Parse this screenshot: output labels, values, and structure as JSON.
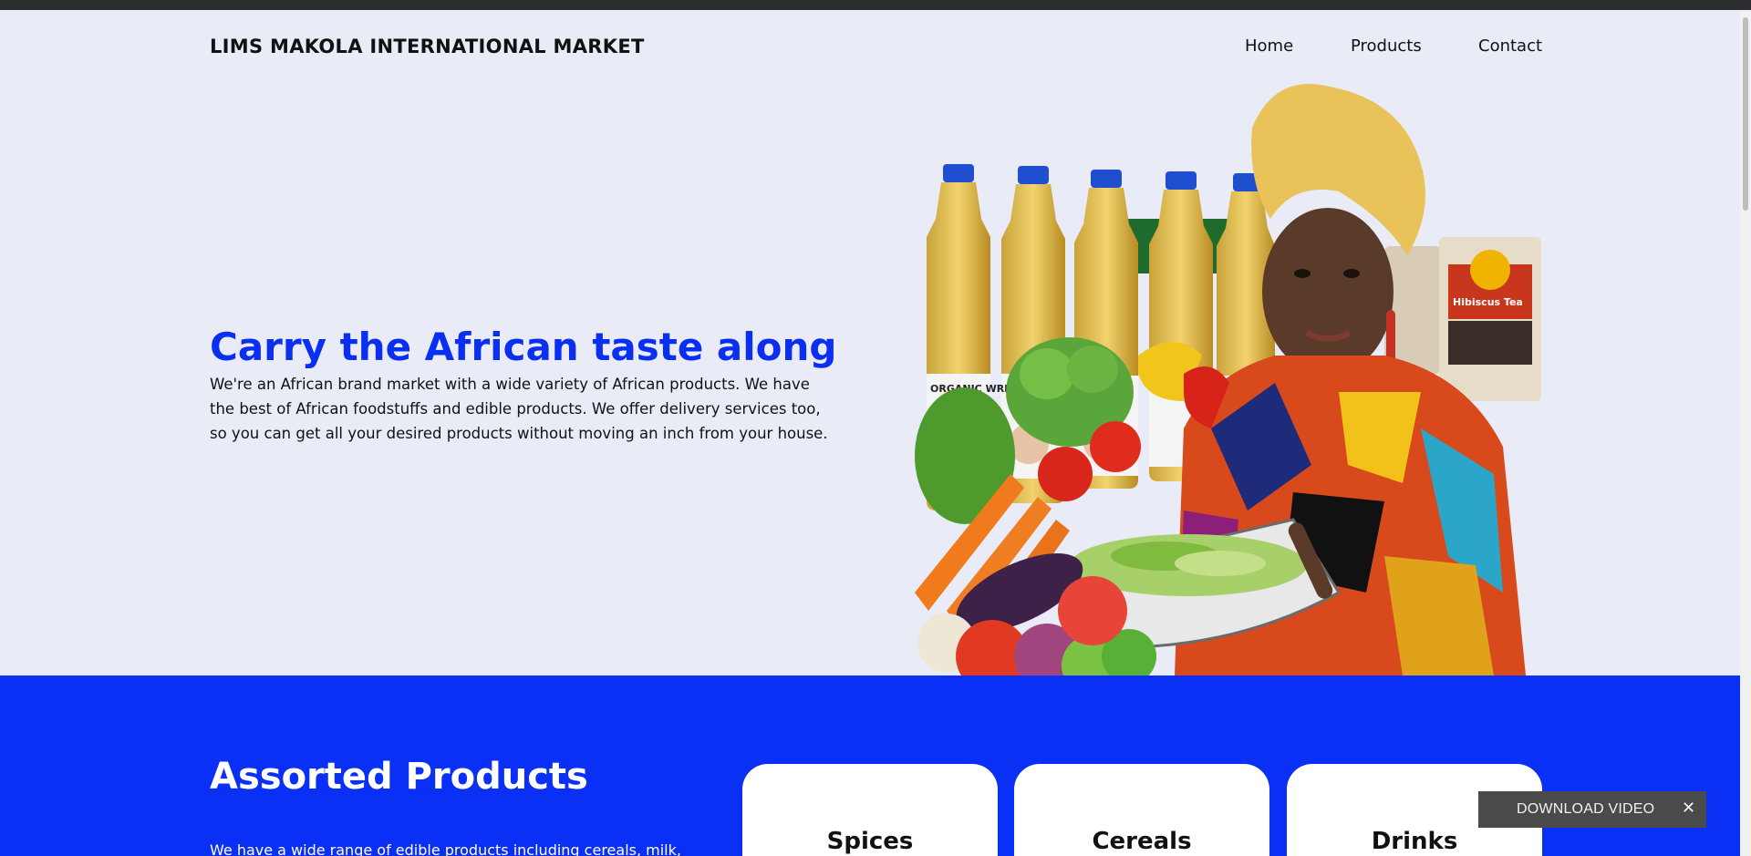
{
  "header": {
    "brand": "LIMS MAKOLA INTERNATIONAL MARKET",
    "nav": {
      "home": "Home",
      "products": "Products",
      "contact": "Contact"
    }
  },
  "hero": {
    "title": "Carry the African taste along",
    "text": "We're an African brand market with a wide variety of African products. We have the best of African foodstuffs and edible products. We offer delivery services too, so you can get all your desired products without moving an inch from your house.",
    "image": {
      "bottle_label": "ORGANIC WREWRE",
      "tea_label": "Hibiscus Tea"
    }
  },
  "assorted": {
    "title": "Assorted Products",
    "text": "We have a wide range of edible products including cereals, milk,",
    "cards": [
      {
        "label": "Spices"
      },
      {
        "label": "Cereals"
      },
      {
        "label": "Drinks"
      }
    ]
  },
  "overlay": {
    "download_label": "DOWNLOAD VIDEO",
    "close_icon": "close-icon"
  },
  "colors": {
    "page_bg": "#e9ecf7",
    "accent_blue": "#0a2ff0",
    "section_blue": "#0a2ff5"
  }
}
